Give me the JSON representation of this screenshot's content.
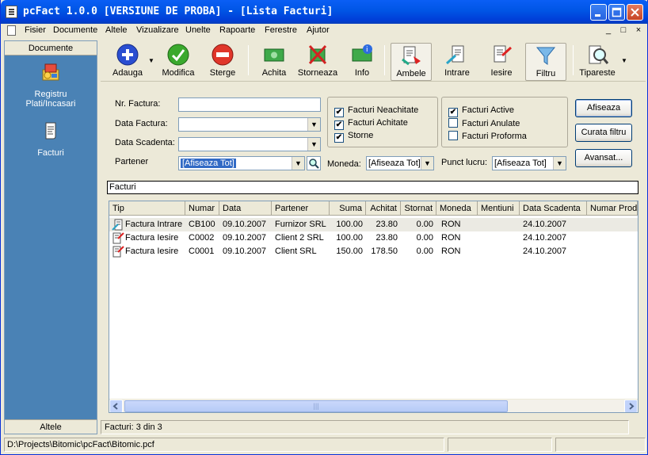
{
  "window": {
    "title": "pcFact 1.0.0 [VERSIUNE DE PROBA] - [Lista Facturi]"
  },
  "menu": {
    "items": [
      "Fisier",
      "Documente",
      "Altele",
      "Vizualizare",
      "Unelte",
      "Rapoarte",
      "Ferestre",
      "Ajutor"
    ]
  },
  "mdi_controls": {
    "minimize": "_",
    "restore": "□",
    "close": "×"
  },
  "sidebar": {
    "header": "Documente",
    "items": [
      {
        "label": "Registru Plati/Incasari",
        "icon": "registry-icon"
      },
      {
        "label": "Facturi",
        "icon": "invoice-icon"
      }
    ],
    "footer": "Altele"
  },
  "toolbar": {
    "add": "Adauga",
    "modify": "Modifica",
    "delete": "Sterge",
    "pay": "Achita",
    "reverse": "Storneaza",
    "info": "Info",
    "both": "Ambele",
    "incoming": "Intrare",
    "outgoing": "Iesire",
    "filter": "Filtru",
    "print": "Tipareste"
  },
  "filter": {
    "nr_factura_label": "Nr. Factura:",
    "data_factura_label": "Data Factura:",
    "data_scadenta_label": "Data Scadenta:",
    "partener_label": "Partener",
    "partener_value": "[Afiseaza Tot]",
    "moneda_label": "Moneda:",
    "moneda_value": "[Afiseaza Tot]",
    "punct_label": "Punct lucru:",
    "punct_value": "[Afiseaza Tot]",
    "status_group": [
      {
        "label": "Facturi Neachitate",
        "checked": true
      },
      {
        "label": "Facturi Achitate",
        "checked": true
      },
      {
        "label": "Storne",
        "checked": true
      }
    ],
    "type_group": [
      {
        "label": "Facturi Active",
        "checked": true
      },
      {
        "label": "Facturi Anulate",
        "checked": false
      },
      {
        "label": "Facturi Proforma",
        "checked": false
      }
    ],
    "show_button": "Afiseaza",
    "clear_button": "Curata filtru",
    "advanced_button": "Avansat..."
  },
  "grid": {
    "title": "Facturi",
    "columns": [
      "Tip",
      "Numar",
      "Data",
      "Partener",
      "Suma",
      "Achitat",
      "Stornat",
      "Moneda",
      "Mentiuni",
      "Data Scadenta",
      "Numar Prod"
    ],
    "rows": [
      {
        "tip": "Factura Intrare",
        "numar": "CB100",
        "data": "09.10.2007",
        "partener": "Furnizor SRL",
        "suma": "100.00",
        "achitat": "23.80",
        "stornat": "0.00",
        "moneda": "RON",
        "mentiuni": "",
        "data_scadenta": "24.10.2007"
      },
      {
        "tip": "Factura Iesire",
        "numar": "C0002",
        "data": "09.10.2007",
        "partener": "Client 2 SRL",
        "suma": "100.00",
        "achitat": "23.80",
        "stornat": "0.00",
        "moneda": "RON",
        "mentiuni": "",
        "data_scadenta": "24.10.2007"
      },
      {
        "tip": "Factura Iesire",
        "numar": "C0001",
        "data": "09.10.2007",
        "partener": "Client SRL",
        "suma": "150.00",
        "achitat": "178.50",
        "stornat": "0.00",
        "moneda": "RON",
        "mentiuni": "",
        "data_scadenta": "24.10.2007"
      }
    ]
  },
  "status": {
    "count": "Facturi: 3 din 3",
    "path": "D:\\Projects\\Bitomic\\pcFact\\Bitomic.pcf"
  }
}
